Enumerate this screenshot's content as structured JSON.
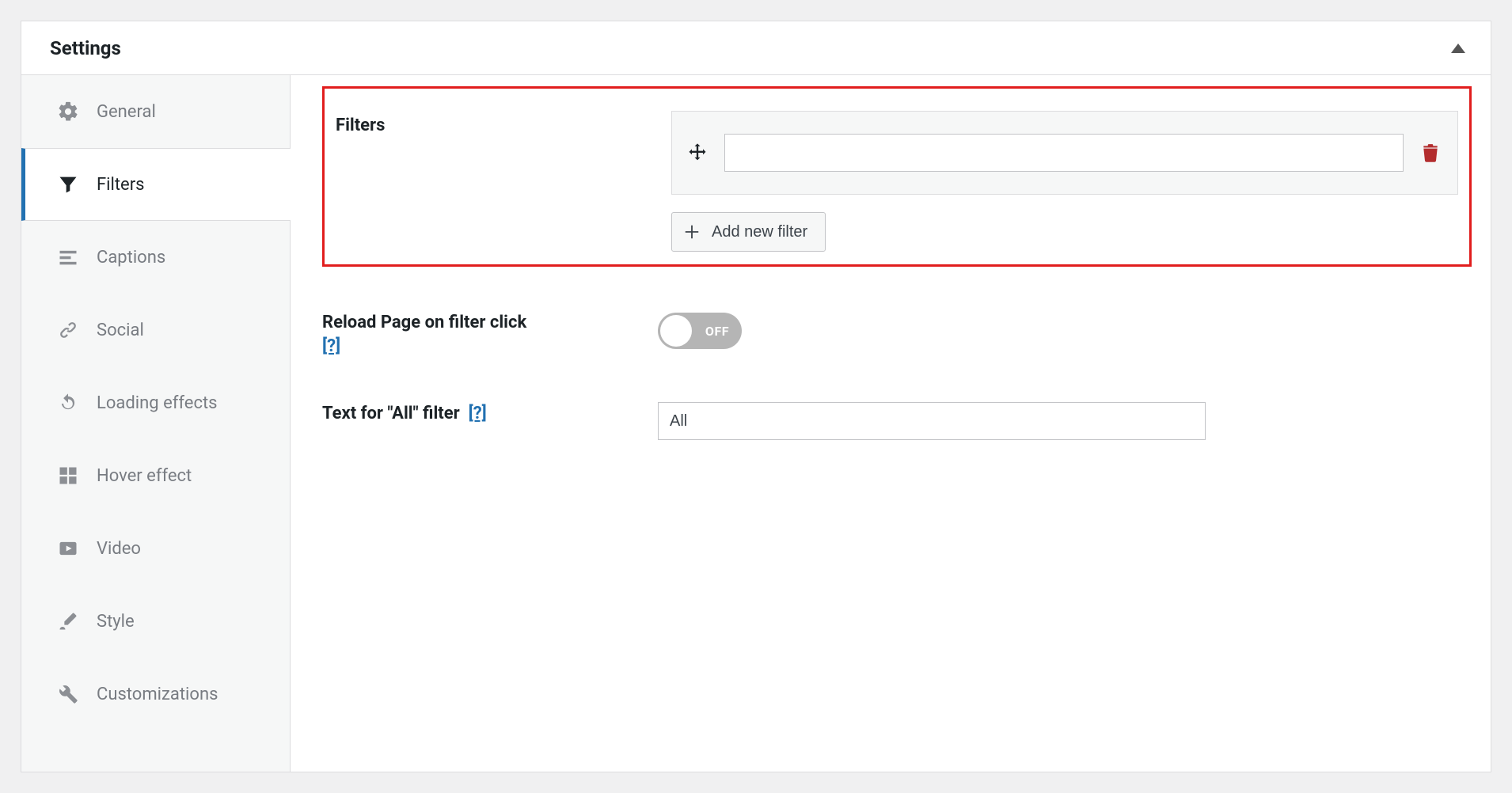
{
  "panel": {
    "title": "Settings"
  },
  "sidebar": {
    "items": [
      {
        "label": "General"
      },
      {
        "label": "Filters"
      },
      {
        "label": "Captions"
      },
      {
        "label": "Social"
      },
      {
        "label": "Loading effects"
      },
      {
        "label": "Hover effect"
      },
      {
        "label": "Video"
      },
      {
        "label": "Style"
      },
      {
        "label": "Customizations"
      }
    ]
  },
  "filters_section": {
    "label": "Filters",
    "filter_value": "",
    "add_button": "Add new filter"
  },
  "reload_section": {
    "label": "Reload Page on filter click",
    "help": "[?]",
    "toggle_state": "OFF"
  },
  "all_text_section": {
    "label": "Text for \"All\" filter",
    "help": "[?]",
    "value": "All"
  }
}
